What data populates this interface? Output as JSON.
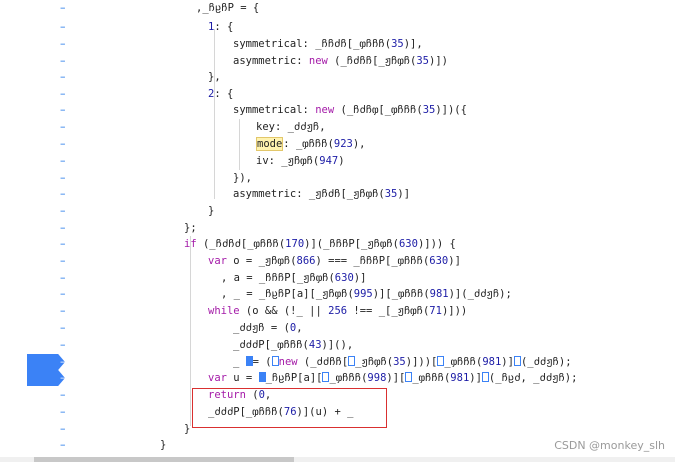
{
  "gutter_mark": "–",
  "lines": [
    {
      "parts": [
        [
          ",",
          "op"
        ],
        [
          "_ჩჸ",
          "plain"
        ],
        [
          "ჩP",
          "plain"
        ],
        [
          " = {",
          "op"
        ]
      ]
    },
    {
      "parts": [
        [
          "1",
          "num"
        ],
        [
          ": {",
          "op"
        ]
      ]
    },
    {
      "parts": [
        [
          "symmetrical",
          "plain"
        ],
        [
          ": ",
          "op"
        ],
        [
          "_ჩჩძჩ[_ჶჩჩჩ",
          "plain"
        ],
        [
          "(",
          "op"
        ],
        [
          "35",
          "num"
        ],
        [
          ")],",
          "op"
        ]
      ]
    },
    {
      "parts": [
        [
          "asymmetric",
          "plain"
        ],
        [
          ": ",
          "op"
        ],
        [
          "new",
          "kw"
        ],
        [
          " (_ჩძჩჩ[_ჟჩჶჩ",
          "plain"
        ],
        [
          "(",
          "op"
        ],
        [
          "35",
          "num"
        ],
        [
          ")])",
          "op"
        ]
      ]
    },
    {
      "parts": [
        [
          "},",
          "op"
        ]
      ]
    },
    {
      "parts": [
        [
          "2",
          "num"
        ],
        [
          ": {",
          "op"
        ]
      ]
    },
    {
      "parts": [
        [
          "symmetrical",
          "plain"
        ],
        [
          ": ",
          "op"
        ],
        [
          "new",
          "kw"
        ],
        [
          " (_ჩძჩჶ[_ჶჩჩჩ",
          "plain"
        ],
        [
          "(",
          "op"
        ],
        [
          "35",
          "num"
        ],
        [
          ")])({",
          "op"
        ]
      ]
    },
    {
      "parts": [
        [
          "key",
          "plain"
        ],
        [
          ": _ძძჟჩ,",
          "op"
        ]
      ]
    },
    {
      "parts": [
        [
          "mode",
          "hl"
        ],
        [
          ": _ჶჩჩჩ",
          "op"
        ],
        [
          "(",
          "op"
        ],
        [
          "923",
          "num"
        ],
        [
          "),",
          "op"
        ]
      ]
    },
    {
      "parts": [
        [
          "iv",
          "plain"
        ],
        [
          ": _ჟჩჶჩ",
          "op"
        ],
        [
          "(",
          "op"
        ],
        [
          "947",
          "num"
        ],
        [
          ")",
          "op"
        ]
      ]
    },
    {
      "parts": [
        [
          "}),",
          "op"
        ]
      ]
    },
    {
      "parts": [
        [
          "asymmetric",
          "plain"
        ],
        [
          ": _ჟჩძჩ[_ჟჩჶჩ",
          "plain"
        ],
        [
          "(",
          "op"
        ],
        [
          "35",
          "num"
        ],
        [
          ")]",
          "op"
        ]
      ]
    },
    {
      "parts": [
        [
          "}",
          "op"
        ]
      ]
    },
    {
      "parts": [
        [
          "};",
          "op"
        ]
      ]
    },
    {
      "parts": [
        [
          "if",
          "kw"
        ],
        [
          " (_ჩძჩძ[_ჶჩჩჩ",
          "plain"
        ],
        [
          "(",
          "op"
        ],
        [
          "170",
          "num"
        ],
        [
          ")](_ჩჩჩP[_ჟჩჶჩ",
          "plain"
        ],
        [
          "(",
          "op"
        ],
        [
          "630",
          "num"
        ],
        [
          ")])) {",
          "op"
        ]
      ]
    },
    {
      "parts": [
        [
          "var",
          "kw"
        ],
        [
          " o = _ჟჩჶჩ",
          "plain"
        ],
        [
          "(",
          "op"
        ],
        [
          "866",
          "num"
        ],
        [
          ") === _ჩჩჩP[_ჶჩჩჩ",
          "plain"
        ],
        [
          "(",
          "op"
        ],
        [
          "630",
          "num"
        ],
        [
          ")]",
          "op"
        ]
      ]
    },
    {
      "parts": [
        [
          ", a = _ჩჩჩP[_ჟჩჶჩ",
          "plain"
        ],
        [
          "(",
          "op"
        ],
        [
          "630",
          "num"
        ],
        [
          ")]",
          "op"
        ]
      ]
    },
    {
      "parts": [
        [
          ", _ = _ჩჸჩP[a][_ჟჩჶჩ",
          "plain"
        ],
        [
          "(",
          "op"
        ],
        [
          "995",
          "num"
        ],
        [
          ")][_ჶჩჩჩ",
          "plain"
        ],
        [
          "(",
          "op"
        ],
        [
          "981",
          "num"
        ],
        [
          ")](_ძძჟჩ);",
          "op"
        ]
      ]
    },
    {
      "parts": [
        [
          "while",
          "kw"
        ],
        [
          " (o && (!_ || ",
          "plain"
        ],
        [
          "256",
          "num"
        ],
        [
          " !== _[_ჟჩჶჩ",
          "plain"
        ],
        [
          "(",
          "op"
        ],
        [
          "71",
          "num"
        ],
        [
          ")]))",
          "op"
        ]
      ]
    },
    {
      "parts": [
        [
          "_ძძჟჩ = (",
          "plain"
        ],
        [
          "0",
          "num"
        ],
        [
          ",",
          "op"
        ]
      ]
    },
    {
      "parts": [
        [
          "_ძძძP[_ჶჩჩჩ",
          "plain"
        ],
        [
          "(",
          "op"
        ],
        [
          "43",
          "num"
        ],
        [
          ")](),",
          "op"
        ]
      ]
    },
    {
      "parts": [
        [
          "_ ",
          "plain"
        ],
        [
          "BPM",
          "bpm"
        ],
        [
          "= (",
          "op"
        ],
        [
          "BPO",
          "bpo"
        ],
        [
          "new",
          "kw"
        ],
        [
          " (_ძძჩჩ[",
          "plain"
        ],
        [
          "BPO",
          "bpo"
        ],
        [
          "_ჟჩჶჩ",
          "plain"
        ],
        [
          "(",
          "op"
        ],
        [
          "35",
          "num"
        ],
        [
          ")]))[",
          "op"
        ],
        [
          "BPO",
          "bpo"
        ],
        [
          "_ჶჩჩჩ",
          "plain"
        ],
        [
          "(",
          "op"
        ],
        [
          "981",
          "num"
        ],
        [
          ")]",
          "op"
        ],
        [
          "BPO",
          "bpo"
        ],
        [
          "(_ძძჟჩ);",
          "plain"
        ]
      ]
    },
    {
      "parts": [
        [
          "var",
          "kw"
        ],
        [
          " u = ",
          "plain"
        ],
        [
          "BPM",
          "bpm"
        ],
        [
          "_ჩჸჩP[a][",
          "plain"
        ],
        [
          "BPO",
          "bpo"
        ],
        [
          "_ჶჩჩჩ",
          "plain"
        ],
        [
          "(",
          "op"
        ],
        [
          "998",
          "num"
        ],
        [
          ")][",
          "op"
        ],
        [
          "BPO",
          "bpo"
        ],
        [
          "_ჶჩჩჩ",
          "plain"
        ],
        [
          "(",
          "op"
        ],
        [
          "981",
          "num"
        ],
        [
          ")]",
          "op"
        ],
        [
          "BPO",
          "bpo"
        ],
        [
          "(_ჩჸძ, _ძძჟჩ);",
          "plain"
        ]
      ]
    },
    {
      "parts": [
        [
          "return",
          "kw"
        ],
        [
          " (",
          "op"
        ],
        [
          "0",
          "num"
        ],
        [
          ",",
          "op"
        ]
      ]
    },
    {
      "parts": [
        [
          "_ძძძP[_ჶჩჩჩ",
          "plain"
        ],
        [
          "(",
          "op"
        ],
        [
          "76",
          "num"
        ],
        [
          ")](u) + _",
          "op"
        ]
      ]
    },
    {
      "parts": [
        [
          "}",
          "op"
        ]
      ]
    },
    {
      "parts": [
        [
          "}",
          "op"
        ]
      ]
    }
  ],
  "watermark": "CSDN @monkey_slh"
}
